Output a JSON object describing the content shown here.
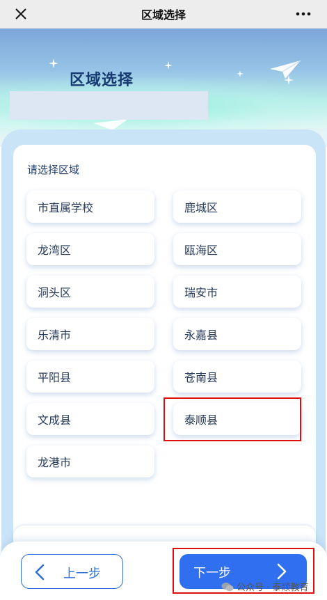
{
  "topbar": {
    "title": "区域选择",
    "close_icon": "close-icon",
    "more_icon": "more-dots-icon"
  },
  "hero": {
    "title": "区域选择"
  },
  "card": {
    "label": "请选择区域",
    "regions": [
      "市直属学校",
      "鹿城区",
      "龙湾区",
      "瓯海区",
      "洞头区",
      "瑞安市",
      "乐清市",
      "永嘉县",
      "平阳县",
      "苍南县",
      "文成县",
      "泰顺县",
      "龙港市"
    ]
  },
  "footer": {
    "prev_label": "上一步",
    "next_label": "下一步",
    "watermark": "公众号 · 泰顺教育"
  },
  "colors": {
    "accent": "#2f6ff0",
    "highlight": "#e00d0d",
    "title": "#173a72"
  }
}
